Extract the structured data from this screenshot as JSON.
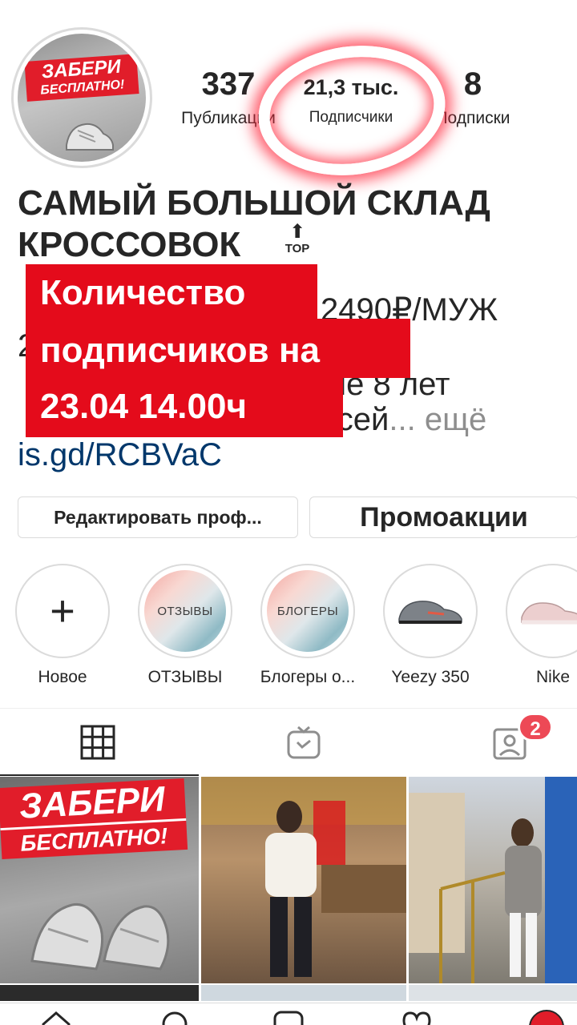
{
  "profile": {
    "avatar_text_line1": "ЗАБЕРИ",
    "avatar_text_line2": "БЕСПЛАТНО!",
    "stats": {
      "posts_count": "337",
      "posts_label": "Публикации",
      "followers_count": "21,3 тыс.",
      "followers_label": "Подписчики",
      "following_count": "8",
      "following_label": "Подписки"
    },
    "bio": {
      "title": "САМЫЙ БОЛЬШОЙ СКЛАД КРОССОВОК",
      "top_badge": "TOP",
      "line1_visible": "Н 2490₽/МУЖ",
      "line2_visible": "2",
      "line3_visible": "ше 8 лет",
      "line4_visible": "всей",
      "more": "... ещё",
      "link": "is.gd/RCBVaC"
    },
    "overlay": {
      "line1": "Количество",
      "line2": "подписчиков на",
      "line3": "23.04 14.00ч"
    }
  },
  "actions": {
    "edit_label": "Редактировать проф...",
    "promo_label": "Промоакции"
  },
  "highlights": [
    {
      "label": "Новое",
      "cover_text": ""
    },
    {
      "label": "ОТЗЫВЫ",
      "cover_text": "ОТЗЫВЫ"
    },
    {
      "label": "Блогеры о...",
      "cover_text": "БЛОГЕРЫ"
    },
    {
      "label": "Yeezy 350",
      "cover_text": ""
    },
    {
      "label": "Nike",
      "cover_text": ""
    }
  ],
  "tabs": {
    "tagged_badge": "2"
  },
  "posts": {
    "post1_line1": "ЗАБЕРИ",
    "post1_line2": "БЕСПЛАТНО!"
  },
  "colors": {
    "accent_red": "#e40b1b",
    "link_blue": "#00376b",
    "badge_red": "#ed4956"
  }
}
